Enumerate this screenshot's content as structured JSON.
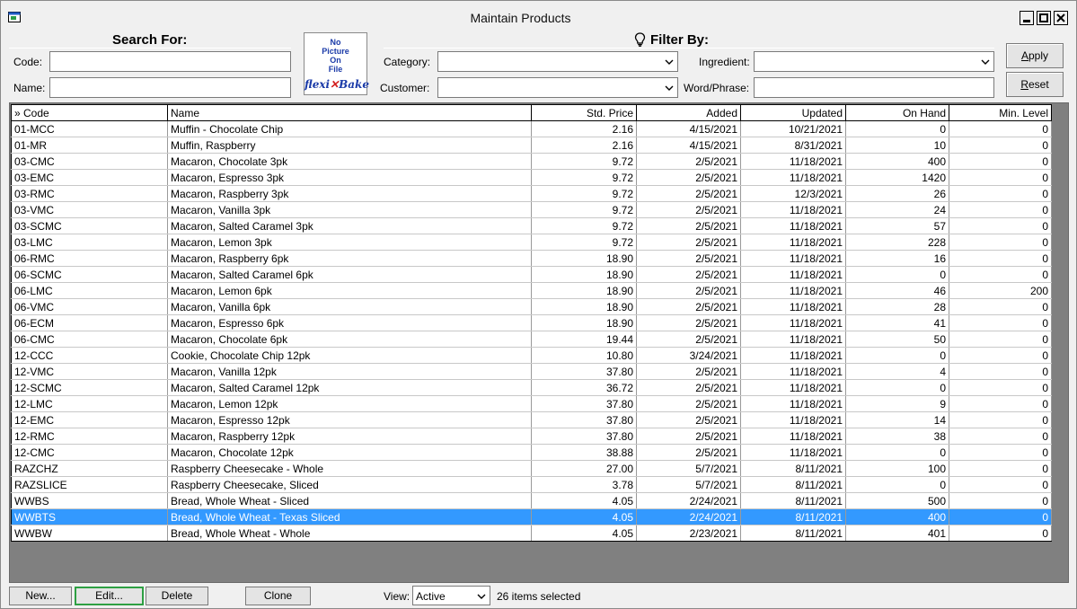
{
  "window": {
    "title": "Maintain Products"
  },
  "search": {
    "heading": "Search For:",
    "code_label": "Code:",
    "code_value": "",
    "name_label": "Name:",
    "name_value": ""
  },
  "picture": {
    "line1": "No",
    "line2": "Picture",
    "line3": "On",
    "line4": "File",
    "brand_a": "flexi",
    "brand_x": "✕",
    "brand_b": "Bake"
  },
  "filter": {
    "heading": "Filter By:",
    "category_label": "Category:",
    "category_value": "",
    "customer_label": "Customer:",
    "customer_value": "",
    "ingredient_label": "Ingredient:",
    "ingredient_value": "",
    "word_label": "Word/Phrase:",
    "word_value": ""
  },
  "buttons": {
    "apply": "Apply",
    "reset": "Reset"
  },
  "table": {
    "headers": [
      "» Code",
      "Name",
      "Std. Price",
      "Added",
      "Updated",
      "On Hand",
      "Min. Level"
    ],
    "rows": [
      [
        "01-MCC",
        "Muffin - Chocolate Chip",
        "2.16",
        "4/15/2021",
        "10/21/2021",
        "0",
        "0"
      ],
      [
        "01-MR",
        "Muffin, Raspberry",
        "2.16",
        "4/15/2021",
        "8/31/2021",
        "10",
        "0"
      ],
      [
        "03-CMC",
        "Macaron, Chocolate 3pk",
        "9.72",
        "2/5/2021",
        "11/18/2021",
        "400",
        "0"
      ],
      [
        "03-EMC",
        "Macaron, Espresso 3pk",
        "9.72",
        "2/5/2021",
        "11/18/2021",
        "1420",
        "0"
      ],
      [
        "03-RMC",
        "Macaron, Raspberry 3pk",
        "9.72",
        "2/5/2021",
        "12/3/2021",
        "26",
        "0"
      ],
      [
        "03-VMC",
        "Macaron, Vanilla 3pk",
        "9.72",
        "2/5/2021",
        "11/18/2021",
        "24",
        "0"
      ],
      [
        "03-SCMC",
        "Macaron, Salted Caramel 3pk",
        "9.72",
        "2/5/2021",
        "11/18/2021",
        "57",
        "0"
      ],
      [
        "03-LMC",
        "Macaron, Lemon 3pk",
        "9.72",
        "2/5/2021",
        "11/18/2021",
        "228",
        "0"
      ],
      [
        "06-RMC",
        "Macaron, Raspberry 6pk",
        "18.90",
        "2/5/2021",
        "11/18/2021",
        "16",
        "0"
      ],
      [
        "06-SCMC",
        "Macaron, Salted Caramel 6pk",
        "18.90",
        "2/5/2021",
        "11/18/2021",
        "0",
        "0"
      ],
      [
        "06-LMC",
        "Macaron, Lemon 6pk",
        "18.90",
        "2/5/2021",
        "11/18/2021",
        "46",
        "200"
      ],
      [
        "06-VMC",
        "Macaron, Vanilla 6pk",
        "18.90",
        "2/5/2021",
        "11/18/2021",
        "28",
        "0"
      ],
      [
        "06-ECM",
        "Macaron, Espresso 6pk",
        "18.90",
        "2/5/2021",
        "11/18/2021",
        "41",
        "0"
      ],
      [
        "06-CMC",
        "Macaron, Chocolate 6pk",
        "19.44",
        "2/5/2021",
        "11/18/2021",
        "50",
        "0"
      ],
      [
        "12-CCC",
        "Cookie, Chocolate Chip 12pk",
        "10.80",
        "3/24/2021",
        "11/18/2021",
        "0",
        "0"
      ],
      [
        "12-VMC",
        "Macaron, Vanilla 12pk",
        "37.80",
        "2/5/2021",
        "11/18/2021",
        "4",
        "0"
      ],
      [
        "12-SCMC",
        "Macaron, Salted Caramel 12pk",
        "36.72",
        "2/5/2021",
        "11/18/2021",
        "0",
        "0"
      ],
      [
        "12-LMC",
        "Macaron, Lemon 12pk",
        "37.80",
        "2/5/2021",
        "11/18/2021",
        "9",
        "0"
      ],
      [
        "12-EMC",
        "Macaron, Espresso 12pk",
        "37.80",
        "2/5/2021",
        "11/18/2021",
        "14",
        "0"
      ],
      [
        "12-RMC",
        "Macaron, Raspberry 12pk",
        "37.80",
        "2/5/2021",
        "11/18/2021",
        "38",
        "0"
      ],
      [
        "12-CMC",
        "Macaron, Chocolate 12pk",
        "38.88",
        "2/5/2021",
        "11/18/2021",
        "0",
        "0"
      ],
      [
        "RAZCHZ",
        "Raspberry Cheesecake - Whole",
        "27.00",
        "5/7/2021",
        "8/11/2021",
        "100",
        "0"
      ],
      [
        "RAZSLICE",
        "Raspberry Cheesecake, Sliced",
        "3.78",
        "5/7/2021",
        "8/11/2021",
        "0",
        "0"
      ],
      [
        "WWBS",
        "Bread, Whole Wheat - Sliced",
        "4.05",
        "2/24/2021",
        "8/11/2021",
        "500",
        "0"
      ],
      [
        "WWBTS",
        "Bread, Whole Wheat - Texas Sliced",
        "4.05",
        "2/24/2021",
        "8/11/2021",
        "400",
        "0"
      ],
      [
        "WWBW",
        "Bread, Whole Wheat - Whole",
        "4.05",
        "2/23/2021",
        "8/11/2021",
        "401",
        "0"
      ]
    ],
    "selected_code": "WWBTS"
  },
  "bottom": {
    "new": "New...",
    "edit": "Edit...",
    "delete": "Delete",
    "clone": "Clone",
    "view_label": "View:",
    "view_value": "Active",
    "status": "26 items selected"
  }
}
